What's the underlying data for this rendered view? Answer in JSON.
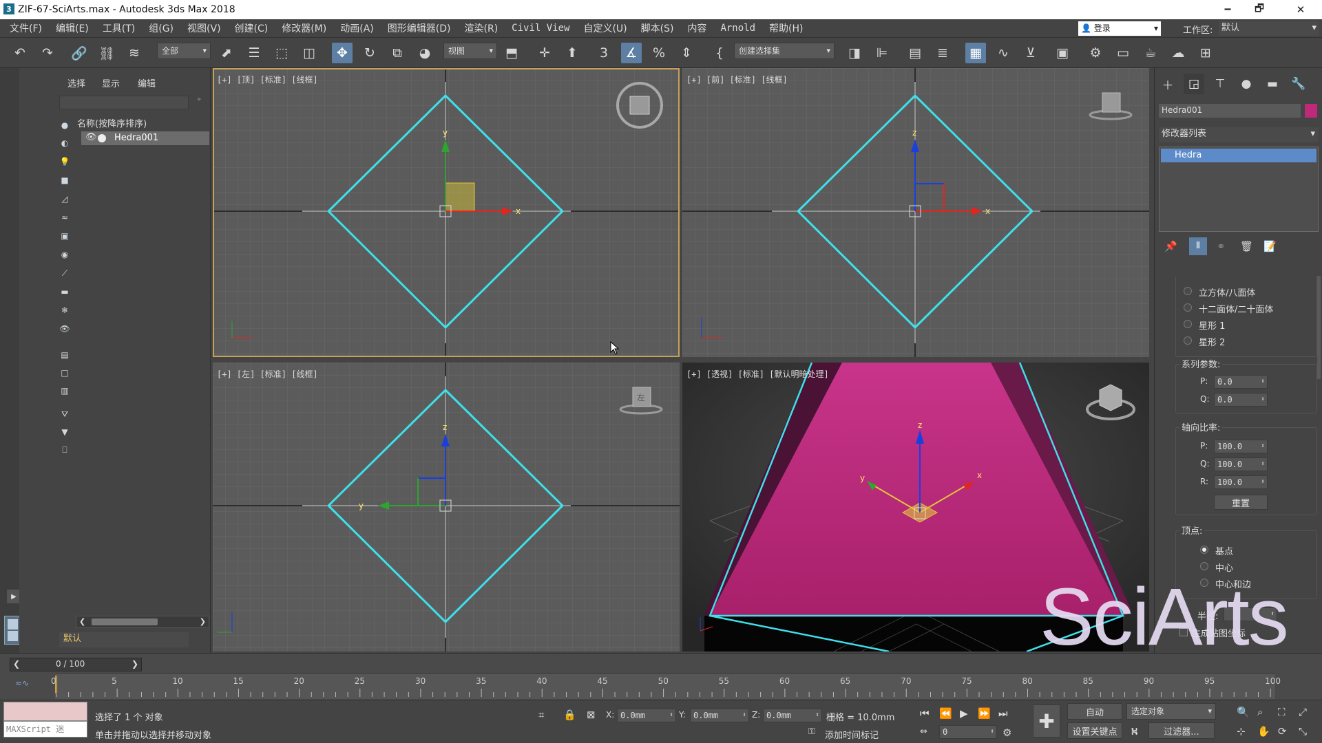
{
  "window": {
    "title": "ZIF-67-SciArts.max - Autodesk 3ds Max 2018",
    "minimize": "🗕",
    "maximize": "🗗",
    "close": "✕"
  },
  "menu": [
    "文件(F)",
    "编辑(E)",
    "工具(T)",
    "组(G)",
    "视图(V)",
    "创建(C)",
    "修改器(M)",
    "动画(A)",
    "图形编辑器(D)",
    "渲染(R)",
    "Civil View",
    "自定义(U)",
    "脚本(S)",
    "内容",
    "Arnold",
    "帮助(H)"
  ],
  "user": {
    "login": "登录",
    "workspace_label": "工作区:",
    "workspace_value": "默认"
  },
  "toolbar": {
    "filter": "全部",
    "ref_coord": "视图",
    "selection_set": "创建选择集"
  },
  "explorer": {
    "tabs": [
      "选择",
      "显示",
      "编辑"
    ],
    "column_header": "名称(按降序排序)",
    "items": [
      {
        "name": "Hedra001"
      }
    ],
    "layer": "默认"
  },
  "viewports": [
    {
      "label": "[+] [顶] [标准] [线框]",
      "active": true
    },
    {
      "label": "[+] [前] [标准] [线框]"
    },
    {
      "label": "[+] [左] [标准] [线框]",
      "cube_face": "左"
    },
    {
      "label": "[+] [透视] [标准] [默认明暗处理]"
    }
  ],
  "axis_labels": {
    "x": "x",
    "y": "y",
    "z": "z"
  },
  "command_panel": {
    "object_name": "Hedra001",
    "object_color": "#c0287a",
    "modifier_list": "修改器列表",
    "stack": [
      "Hedra"
    ],
    "family": [
      "立方体/八面体",
      "十二面体/二十面体",
      "星形 1",
      "星形 2"
    ],
    "family_params_title": "系列参数:",
    "family_params": [
      {
        "k": "P:",
        "v": "0.0"
      },
      {
        "k": "Q:",
        "v": "0.0"
      }
    ],
    "axis_scale_title": "轴向比率:",
    "axis_scale": [
      {
        "k": "P:",
        "v": "100.0"
      },
      {
        "k": "Q:",
        "v": "100.0"
      },
      {
        "k": "R:",
        "v": "100.0"
      }
    ],
    "reset": "重置",
    "vertices_title": "顶点:",
    "vertices": [
      "基点",
      "中心",
      "中心和边"
    ],
    "vertices_selected": 0,
    "radius_label": "半径:",
    "gen_mapping": "生成贴图坐标"
  },
  "timeline": {
    "counter": "0 / 100",
    "ticks": [
      "0",
      "5",
      "10",
      "15",
      "20",
      "25",
      "30",
      "35",
      "40",
      "45",
      "50",
      "55",
      "60",
      "65",
      "70",
      "75",
      "80",
      "85",
      "90",
      "95",
      "100"
    ]
  },
  "status": {
    "maxscript": "MAXScript 迷",
    "selected": "选择了 1 个 对象",
    "prompt": "单击并拖动以选择并移动对象",
    "x_label": "X:",
    "x": "0.0mm",
    "y_label": "Y:",
    "y": "0.0mm",
    "z_label": "Z:",
    "z": "0.0mm",
    "grid": "栅格 = 10.0mm",
    "add_time_tag": "添加时间标记",
    "auto_key": "自动",
    "set_key": "设置关键点",
    "sel_filter": "选定对象",
    "filters": "过滤器...",
    "frame": "0"
  },
  "watermark": "SciArts",
  "colors": {
    "wire": "#3ee0ea",
    "object": "#c0287a",
    "active_border": "#c9a25a",
    "x_axis": "#e0261e",
    "y_axis": "#2ea52e",
    "z_axis": "#1a3fe0"
  }
}
